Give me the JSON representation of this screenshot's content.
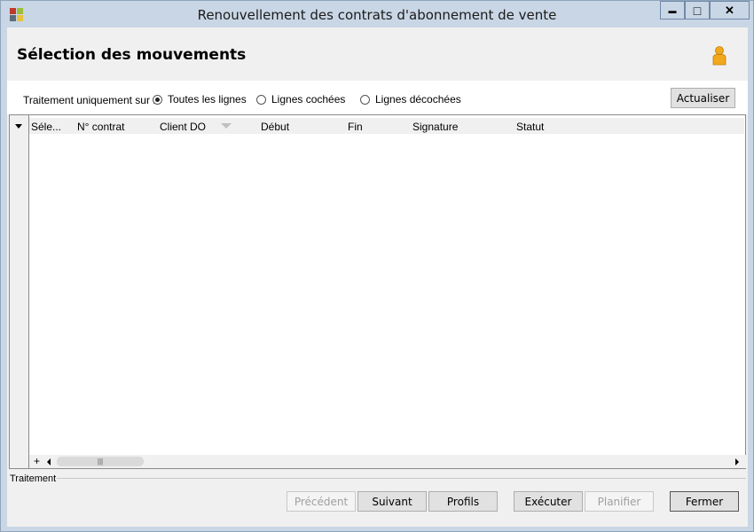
{
  "window": {
    "title": "Renouvellement des contrats d'abonnement de vente",
    "controls": {
      "minimize": "▬",
      "maximize": "□",
      "close": "✕"
    }
  },
  "header": {
    "title": "Sélection des mouvements",
    "user_icon": "user-icon"
  },
  "filter": {
    "label": "Traitement uniquement sur :",
    "options": [
      {
        "label": "Toutes les lignes",
        "selected": true
      },
      {
        "label": "Lignes cochées",
        "selected": false
      },
      {
        "label": "Lignes décochées",
        "selected": false
      }
    ],
    "refresh_button": "Actualiser"
  },
  "grid": {
    "columns": [
      "Séle...",
      "N° contrat",
      "Client DO",
      "Début",
      "Fin",
      "Signature",
      "Statut"
    ],
    "sorted_column": "Client DO",
    "rows": [],
    "scroll_add": "+",
    "scroll_thumb": "|||"
  },
  "section": {
    "label": "Traitement"
  },
  "footer": {
    "previous": "Précédent",
    "next": "Suivant",
    "profiles": "Profils",
    "execute": "Exécuter",
    "schedule": "Planifier",
    "close": "Fermer"
  },
  "colors": {
    "titlebar": "#c9d6e5",
    "client": "#f0f0f0",
    "user_icon": "#f2a81d"
  }
}
